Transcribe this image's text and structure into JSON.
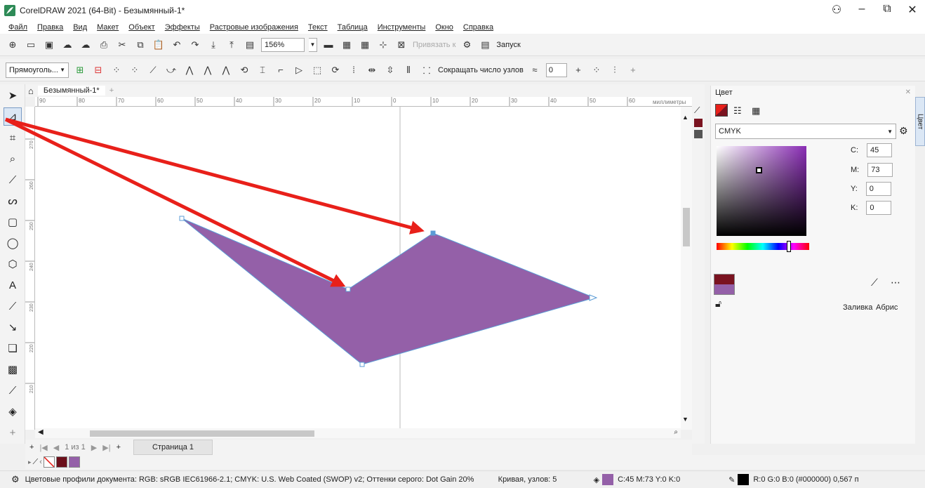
{
  "app": {
    "title": "CorelDRAW 2021 (64-Bit) - Безымянный-1*"
  },
  "menu": [
    "Файл",
    "Правка",
    "Вид",
    "Макет",
    "Объект",
    "Эффекты",
    "Растровые изображения",
    "Текст",
    "Таблица",
    "Инструменты",
    "Окно",
    "Справка"
  ],
  "toolbar1": {
    "zoom": "156%",
    "snap_label": "Привязать к",
    "launch_label": "Запуск"
  },
  "toolbar2": {
    "shape_select": "Прямоуголь...",
    "reduce_nodes_label": "Сокращать число узлов",
    "smoothing_value": "0"
  },
  "document": {
    "tab_name": "Безымянный-1*"
  },
  "ruler": {
    "unit": "миллиметры",
    "h_ticks": [
      "90",
      "80",
      "70",
      "60",
      "50",
      "40",
      "30",
      "20",
      "10",
      "0",
      "10",
      "20",
      "30",
      "40",
      "50",
      "60"
    ],
    "v_ticks": [
      "270",
      "260",
      "250",
      "240",
      "230",
      "220",
      "210"
    ]
  },
  "page": {
    "counter": "1 из 1",
    "tab": "Страница 1"
  },
  "color_panel": {
    "title": "Цвет",
    "model": "CMYK",
    "c_label": "C:",
    "c": "45",
    "m_label": "M:",
    "m": "73",
    "y_label": "Y:",
    "y": "0",
    "k_label": "K:",
    "k": "0",
    "fill_label": "Заливка",
    "outline_label": "Абрис",
    "side_tab": "Цвет"
  },
  "colors": {
    "fill": "#9460a8",
    "outline": "#5b9bd5",
    "arrow": "#e8201a",
    "dark_red": "#7a1320"
  },
  "status": {
    "profiles": "Цветовые профили документа: RGB: sRGB IEC61966-2.1; CMYK: U.S. Web Coated (SWOP) v2; Оттенки серого: Dot Gain 20%",
    "object_info": "Кривая, узлов: 5",
    "fill_info": "C:45 M:73 Y:0 K:0",
    "outline_info": "R:0 G:0 B:0 (#000000)  0,567 п"
  }
}
